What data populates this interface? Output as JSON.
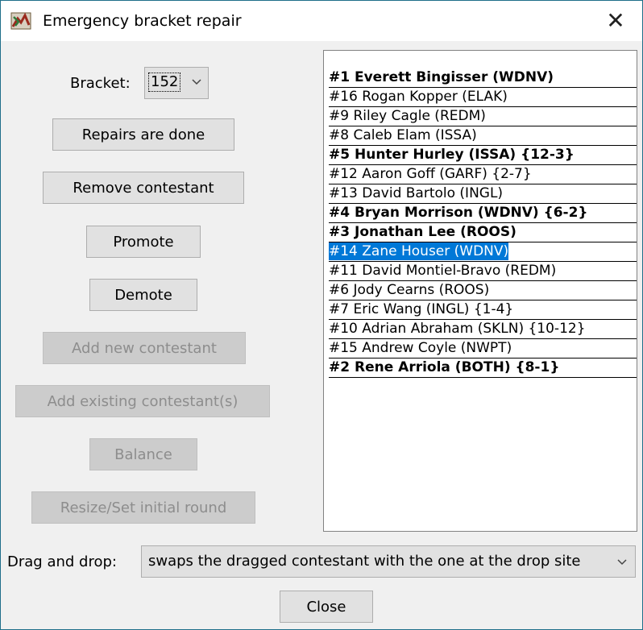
{
  "window": {
    "title": "Emergency bracket repair",
    "app_icon": "bracket-app-icon",
    "close_icon": "close-icon"
  },
  "bracket": {
    "label": "Bracket:",
    "value": "152"
  },
  "buttons": {
    "repairs_done": "Repairs are done",
    "remove_contestant": "Remove contestant",
    "promote": "Promote",
    "demote": "Demote",
    "add_new": "Add new contestant",
    "add_existing": "Add existing contestant(s)",
    "balance": "Balance",
    "resize": "Resize/Set initial round",
    "close": "Close"
  },
  "contestants": [
    {
      "text": "#1 Everett Bingisser (WDNV)",
      "bold": true,
      "selected": false
    },
    {
      "text": "#16 Rogan Kopper (ELAK)",
      "bold": false,
      "selected": false
    },
    {
      "text": "#9 Riley Cagle (REDM)",
      "bold": false,
      "selected": false
    },
    {
      "text": "#8 Caleb Elam (ISSA)",
      "bold": false,
      "selected": false
    },
    {
      "text": "#5 Hunter Hurley (ISSA) {12-3}",
      "bold": true,
      "selected": false
    },
    {
      "text": "#12 Aaron Goff (GARF) {2-7}",
      "bold": false,
      "selected": false
    },
    {
      "text": "#13 David Bartolo (INGL)",
      "bold": false,
      "selected": false
    },
    {
      "text": "#4 Bryan Morrison (WDNV) {6-2}",
      "bold": true,
      "selected": false
    },
    {
      "text": "#3 Jonathan Lee (ROOS)",
      "bold": true,
      "selected": false
    },
    {
      "text": "#14 Zane Houser (WDNV)",
      "bold": false,
      "selected": true
    },
    {
      "text": "#11 David Montiel-Bravo (REDM)",
      "bold": false,
      "selected": false
    },
    {
      "text": "#6 Jody Cearns (ROOS)",
      "bold": false,
      "selected": false
    },
    {
      "text": "#7 Eric Wang (INGL) {1-4}",
      "bold": false,
      "selected": false
    },
    {
      "text": "#10 Adrian Abraham (SKLN) {10-12}",
      "bold": false,
      "selected": false
    },
    {
      "text": "#15 Andrew Coyle (NWPT)",
      "bold": false,
      "selected": false
    },
    {
      "text": "#2 Rene Arriola (BOTH) {8-1}",
      "bold": true,
      "selected": false
    }
  ],
  "drag_drop": {
    "label": "Drag and drop:",
    "value": "swaps the dragged contestant with the one at the drop site"
  },
  "colors": {
    "selection": "#0078d7",
    "button_face": "#e1e1e1",
    "disabled_text": "#8d8d8d"
  }
}
